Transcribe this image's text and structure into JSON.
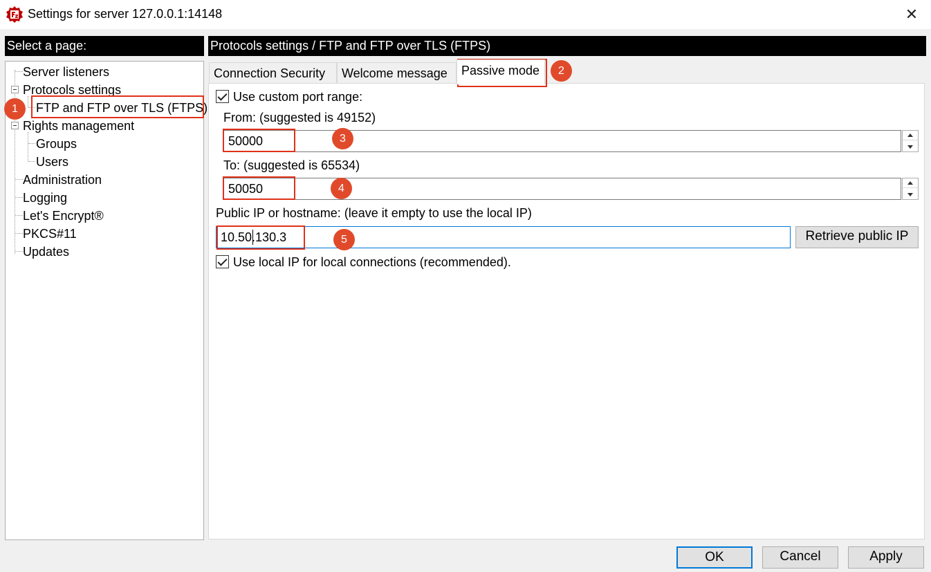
{
  "window": {
    "title": "Settings for server 127.0.0.1:14148",
    "close_glyph": "✕"
  },
  "sidebar": {
    "header": "Select a page:",
    "items": [
      {
        "label": "Server listeners"
      },
      {
        "label": "Protocols settings"
      },
      {
        "label": "FTP and FTP over TLS (FTPS)"
      },
      {
        "label": "Rights management"
      },
      {
        "label": "Groups"
      },
      {
        "label": "Users"
      },
      {
        "label": "Administration"
      },
      {
        "label": "Logging"
      },
      {
        "label": "Let's Encrypt®"
      },
      {
        "label": "PKCS#11"
      },
      {
        "label": "Updates"
      }
    ]
  },
  "main": {
    "header": "Protocols settings / FTP and FTP over TLS (FTPS)",
    "tabs": [
      {
        "label": "Connection Security"
      },
      {
        "label": "Welcome message"
      },
      {
        "label": "Passive mode"
      }
    ],
    "active_tab": "Passive mode",
    "custom_port_range": {
      "label": "Use custom port range:",
      "checked": true
    },
    "from": {
      "label": "From: (suggested is 49152)",
      "value": "50000"
    },
    "to": {
      "label": "To: (suggested is 65534)",
      "value": "50050"
    },
    "public_ip": {
      "label": "Public IP or hostname: (leave it empty to use the local IP)",
      "value": "10.50.130.3",
      "retrieve_label": "Retrieve public IP"
    },
    "local_ip": {
      "label": "Use local IP for local connections (recommended).",
      "checked": true
    }
  },
  "footer": {
    "ok_label": "OK",
    "cancel_label": "Cancel",
    "apply_label": "Apply"
  },
  "annotations": [
    "1",
    "2",
    "3",
    "4",
    "5"
  ],
  "colors": {
    "annotation": "#e0311a",
    "badge": "#e04a2b",
    "focus": "#0078d7",
    "header_bg": "#000000"
  }
}
